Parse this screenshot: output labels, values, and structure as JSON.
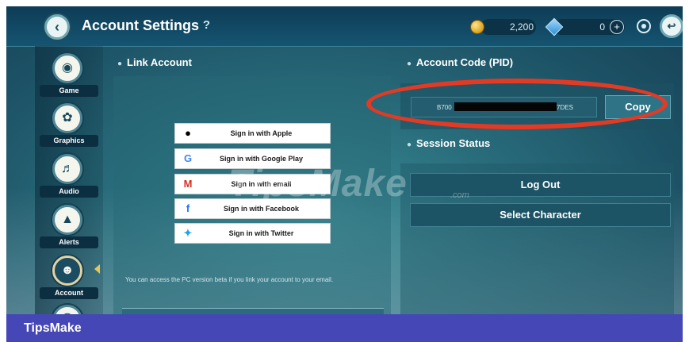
{
  "header": {
    "title": "Account Settings",
    "help": "?",
    "coins": "2,200",
    "gems": "0",
    "plus": "+"
  },
  "sidebar": {
    "items": [
      {
        "label": "Game",
        "icon": "gamepad-icon"
      },
      {
        "label": "Graphics",
        "icon": "palette-icon"
      },
      {
        "label": "Audio",
        "icon": "speaker-icon"
      },
      {
        "label": "Alerts",
        "icon": "bell-icon"
      },
      {
        "label": "Account",
        "icon": "user-icon"
      }
    ]
  },
  "link_account": {
    "header": "Link Account",
    "buttons": [
      {
        "label": "Sign in with Apple",
        "icon": "apple-icon",
        "color": "#000000"
      },
      {
        "label": "Sign in with Google Play",
        "icon": "google-icon",
        "color": "#4285f4"
      },
      {
        "label": "Sign in with email",
        "icon": "gmail-icon",
        "color": "#d93025"
      },
      {
        "label": "Sign in with Facebook",
        "icon": "facebook-icon",
        "color": "#1877f2"
      },
      {
        "label": "Sign in with Twitter",
        "icon": "twitter-icon",
        "color": "#1da1f2"
      }
    ],
    "note": "You can access the PC version beta if you link your account to your email."
  },
  "account_code": {
    "header": "Account Code (PID)",
    "pid_start": "B700",
    "pid_end": "7DES",
    "copy_label": "Copy"
  },
  "session": {
    "header": "Session Status",
    "logout_label": "Log Out",
    "select_label": "Select Character"
  },
  "watermark": {
    "text": "TipsMake",
    "sub": ".com"
  },
  "footer": {
    "brand": "TipsMake"
  },
  "colors": {
    "highlight_ellipse": "#e43a24",
    "footer_bg": "#4547b7"
  }
}
